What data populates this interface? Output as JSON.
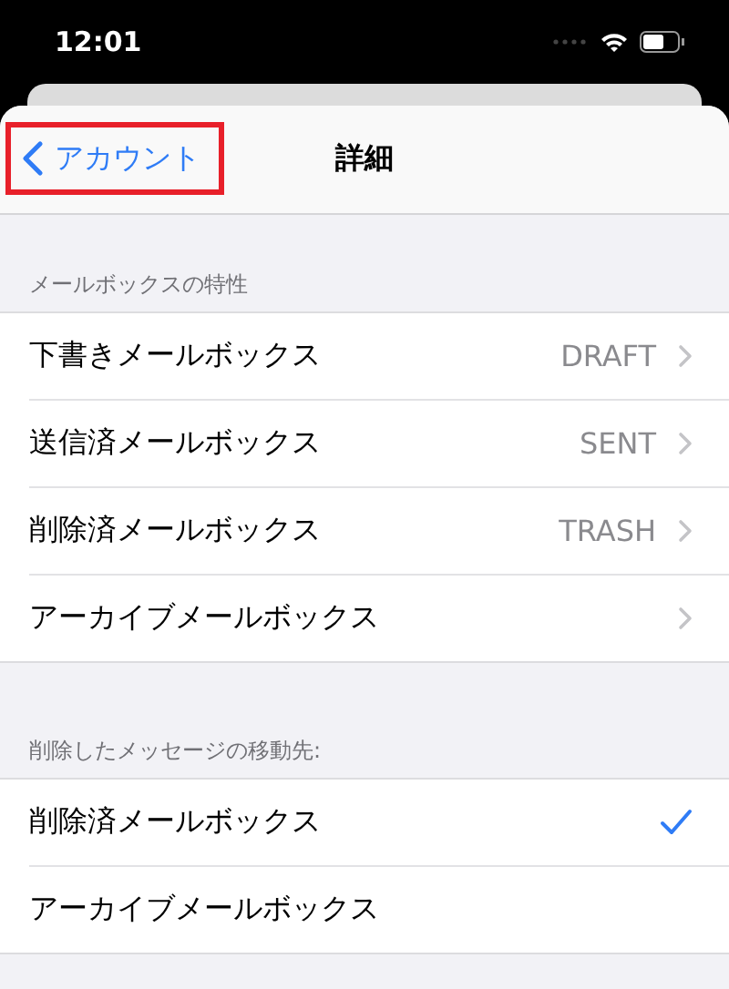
{
  "status_bar": {
    "time": "12:01"
  },
  "nav": {
    "back": {
      "label": "アカウント",
      "highlighted": true
    },
    "title": "詳細"
  },
  "sections": [
    {
      "header": "メールボックスの特性",
      "kind": "disclosure",
      "rows": [
        {
          "label": "下書きメールボックス",
          "value": "DRAFT"
        },
        {
          "label": "送信済メールボックス",
          "value": "SENT"
        },
        {
          "label": "削除済メールボックス",
          "value": "TRASH"
        },
        {
          "label": "アーカイブメールボックス"
        }
      ]
    },
    {
      "header": "削除したメッセージの移動先:",
      "kind": "choice",
      "rows": [
        {
          "label": "削除済メールボックス",
          "selected": true
        },
        {
          "label": "アーカイブメールボックス",
          "selected": false
        }
      ]
    }
  ]
}
